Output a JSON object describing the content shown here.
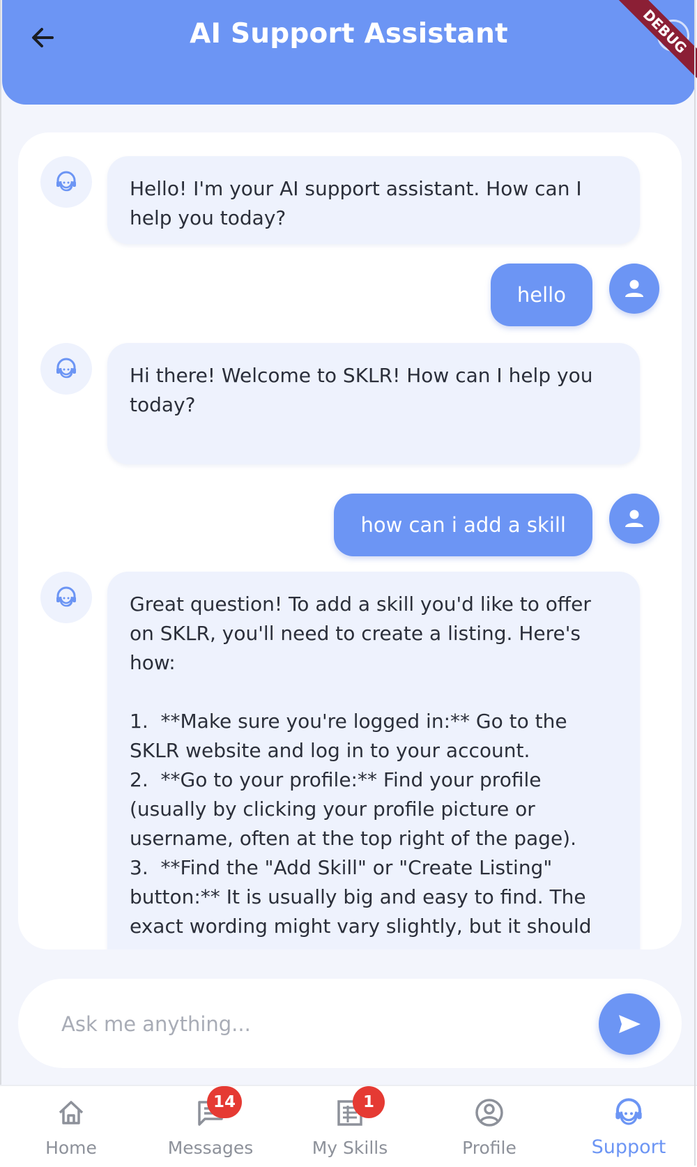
{
  "header": {
    "title": "AI Support Assistant",
    "debug_label": "DEBUG"
  },
  "messages": [
    {
      "sender": "bot",
      "text": "Hello! I'm your AI support assistant. How can I help you today?"
    },
    {
      "sender": "user",
      "text": "hello"
    },
    {
      "sender": "bot",
      "text": "Hi there! Welcome to SKLR! How can I help you today?"
    },
    {
      "sender": "user",
      "text": "how can i add a skill"
    },
    {
      "sender": "bot",
      "text": "Great question! To add a skill you'd like to offer on SKLR, you'll need to create a listing. Here's how:\n\n1.  **Make sure you're logged in:** Go to the SKLR website and log in to your account.\n2.  **Go to your profile:** Find your profile (usually by clicking your profile picture or username, often at the top right of the page).\n3.  **Find the \"Add Skill\" or \"Create Listing\" button:** It is usually big and easy to find. The exact wording might vary slightly, but it should"
    }
  ],
  "input": {
    "placeholder": "Ask me anything..."
  },
  "nav": {
    "items": [
      {
        "label": "Home",
        "icon": "home-icon"
      },
      {
        "label": "Messages",
        "icon": "messages-icon",
        "badge": "14"
      },
      {
        "label": "My Skills",
        "icon": "skills-list-icon",
        "badge": "1"
      },
      {
        "label": "Profile",
        "icon": "profile-icon"
      },
      {
        "label": "Support",
        "icon": "support-agent-icon",
        "active": true
      }
    ]
  },
  "colors": {
    "accent": "#6c95f4",
    "bubble_bot": "#eef2fd",
    "badge": "#e53a33",
    "background": "#f3f5fc"
  }
}
